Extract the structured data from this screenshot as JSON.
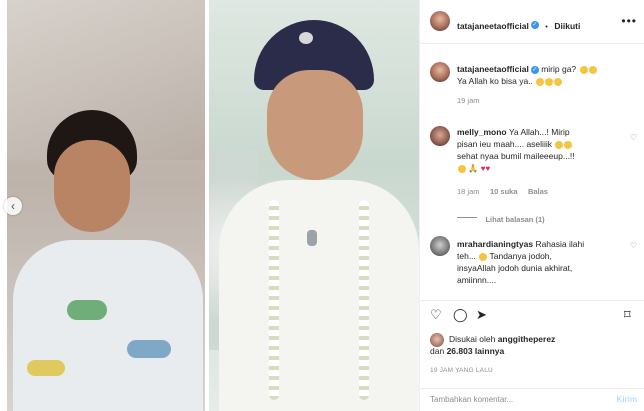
{
  "post": {
    "author": "tatajaneetaofficial",
    "follow_label": "Diikuti",
    "separator": "•"
  },
  "caption": {
    "user": "tatajaneetaofficial",
    "line1": "mirip ga?",
    "line2": "Ya Allah ko bisa ya..",
    "time": "19 jam"
  },
  "comments": [
    {
      "user": "melly_mono",
      "text1": "Ya Allah...! Mirip",
      "text2": "pisan ieu maah.... aseliiik",
      "text3": "sehat nyaa bumil maileeeup...!!",
      "time": "18 jam",
      "likes": "10 suka",
      "reply": "Balas",
      "view_replies": "Lihat balasan (1)"
    },
    {
      "user": "mrahardianingtyas",
      "text1": "Rahasia ilahi",
      "text2": "teh...",
      "text3": "Tandanya jodoh,",
      "text4": "insyaAllah jodoh dunia akhirat,",
      "text5": "amiinnn...."
    }
  ],
  "likes": {
    "prefix": "Disukai oleh",
    "user": "anggitheperez",
    "joiner": "dan",
    "count": "26.803 lainnya"
  },
  "timestamp": "19 JAM YANG LALU",
  "composer": {
    "placeholder": "Tambahkan komentar...",
    "send_label": "Kirim"
  },
  "icons": {
    "heart": "heart-icon",
    "comment": "comment-icon",
    "share": "share-icon",
    "save": "bookmark-icon",
    "more": "more-icon",
    "emoji": "emoji-icon",
    "prev": "chevron-left-icon"
  },
  "colors": {
    "link": "#3897f0",
    "muted": "#8e8e8e",
    "text": "#262626"
  }
}
